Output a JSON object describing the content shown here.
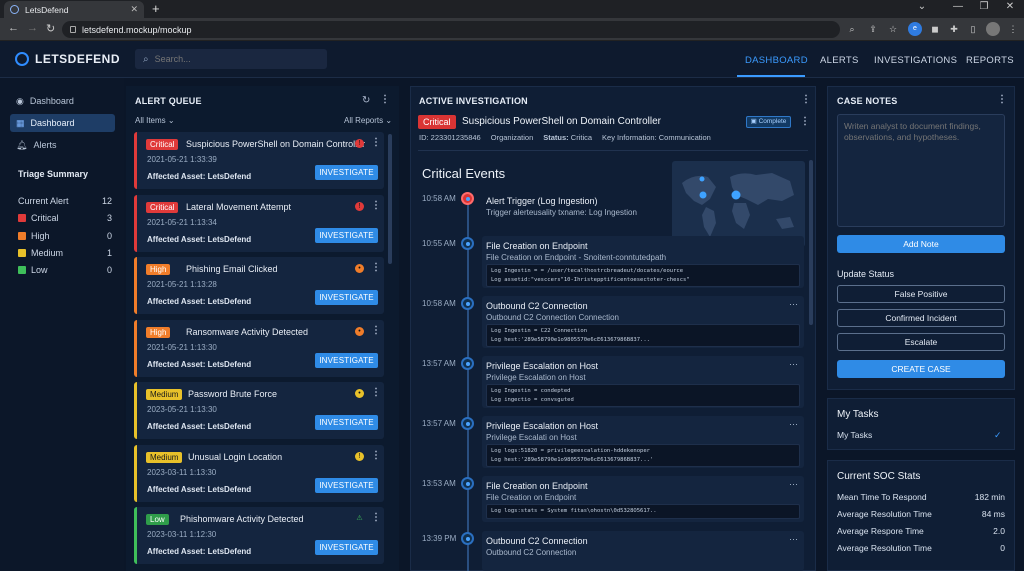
{
  "browser": {
    "tab_title": "LetsDefend",
    "url": "letsdefend.mockup/mockup"
  },
  "app": {
    "logo": "LETSDEFEND",
    "search_placeholder": "Search...",
    "nav": [
      "DASHBOARD",
      "ALERTS",
      "INVESTIGATIONS",
      "REPORTS"
    ]
  },
  "sidebar": {
    "items": [
      "Dashboard",
      "Dashboard",
      "Alerts"
    ],
    "triage_title": "Triage Summary",
    "triage": [
      {
        "label": "Current Alert",
        "value": "12"
      },
      {
        "label": "Critical",
        "value": "3",
        "color": "#e03a3a"
      },
      {
        "label": "High",
        "value": "0",
        "color": "#f07d2a"
      },
      {
        "label": "Medium",
        "value": "1",
        "color": "#e8c12a"
      },
      {
        "label": "Low",
        "value": "0",
        "color": "#3fbf5a"
      }
    ]
  },
  "queue": {
    "title": "ALERT QUEUE",
    "filter_items": "All Items",
    "filter_reports": "All Reports",
    "button_label": "INVESTIGATE",
    "alerts": [
      {
        "severity": "Critical",
        "title": "Suspicious PowerShell on Domain Controller",
        "date": "2021-05-21 1:33:39",
        "asset": "Affected Asset: LetsDefend",
        "color": "#e03a3a",
        "status": "!"
      },
      {
        "severity": "Critical",
        "title": "Lateral Movement Attempt",
        "date": "2021-05-21 1:13:34",
        "asset": "Affected Asset: LetsDefend",
        "color": "#e03a3a",
        "status": "!"
      },
      {
        "severity": "High",
        "title": "Phishing Email Clicked",
        "date": "2021-05-21 1:13:28",
        "asset": "Affected Asset: LetsDefend",
        "color": "#f07d2a",
        "status": "•"
      },
      {
        "severity": "High",
        "title": "Ransomware Activity Detected",
        "date": "2021-05-21 1:13:30",
        "asset": "Affected Asset: LetsDefend",
        "color": "#f07d2a",
        "status": "•"
      },
      {
        "severity": "Medium",
        "title": "Password Brute Force",
        "date": "2023-05-21 1:13:30",
        "asset": "Affected Asset: LetsDefend",
        "color": "#e8c12a",
        "status": "•"
      },
      {
        "severity": "Medium",
        "title": "Unusual Login Location",
        "date": "2023-03-11 1:13:30",
        "asset": "Affected Asset: LetsDefend",
        "color": "#e8c12a",
        "status": "!"
      },
      {
        "severity": "Low",
        "title": "Phishomware Activity Detected",
        "date": "2023-03-11 1:12:30",
        "asset": "Affected Asset: LetsDefend",
        "color": "#3fbf5a",
        "status": "⚠"
      }
    ]
  },
  "investigation": {
    "title": "ACTIVE INVESTIGATION",
    "severity": "Critical",
    "name": "Suspicious PowerShell on Domain Controller",
    "complete_label": "Complete",
    "id": "ID: 223301235846",
    "org": "Organization",
    "status_label": "Status:",
    "status_value": "Critica",
    "key_info": "Key Information: Communication",
    "events_title": "Critical Events",
    "events": [
      {
        "time": "10:58 AM",
        "title": "Alert Trigger (Log Ingestion)",
        "sub": "Trigger alerteusality txname: Log Ingestion",
        "log": []
      },
      {
        "time": "10:55 AM",
        "title": "File Creation on Endpoint",
        "sub": "File Creation on Endpoint - Snoitent-conntutedpath",
        "log": [
          "Log Ingestin = = /user/tecalthostrcbreadeut/docates/eource",
          "Log assetid:\"vesccers\"10-Ihristepptificentoesectoter-chescs\""
        ]
      },
      {
        "time": "10:58 AM",
        "title": "Outbound C2 Connection",
        "sub": "Outbound C2 Connection Connection",
        "log": [
          "Log Ingestin = C22 Connection",
          "Log hest:'289e58790e1o9805570e6cE61367986B837..."
        ]
      },
      {
        "time": "13:57 AM",
        "title": "Privilege Escalation on Host",
        "sub": "Privilege Escalation on Host",
        "log": [
          "Log Ingestin = condepted",
          "Log ingectio = convsguted"
        ]
      },
      {
        "time": "13:57 AM",
        "title": "Privilege Escalation on Host",
        "sub": "Privilege Escalati on Host",
        "log": [
          "Log logs:51820 = privilegeescalation-hddekenoper",
          "Log hest:'289e58790e1o9805570e6cE61367986B837...'"
        ]
      },
      {
        "time": "13:53 AM",
        "title": "File Creation on Endpoint",
        "sub": "File Creation on Endpoint",
        "log": [
          "Log logs:stats = System fitas\\ohostn\\0d5328O5617.."
        ]
      },
      {
        "time": "13:39 PM",
        "title": "Outbound C2 Connection",
        "sub": "Outbound C2 Connection",
        "log": []
      }
    ]
  },
  "notes": {
    "title": "CASE NOTES",
    "placeholder": "Writen analyst to document findings, observations, and hypotheses.",
    "add_note": "Add Note",
    "update_status": "Update Status",
    "buttons": [
      "False Positive",
      "Confirmed Incident",
      "Escalate"
    ],
    "create_case": "CREATE CASE",
    "tasks_title": "My Tasks",
    "task_item": "My Tasks",
    "stats_title": "Current SOC Stats",
    "stats": [
      {
        "label": "Mean Time To Respond",
        "value": "182 min"
      },
      {
        "label": "Average Resolution Time",
        "value": "84 ms"
      },
      {
        "label": "Average Respore Time",
        "value": "2.0"
      },
      {
        "label": "Average Resolution Time",
        "value": "0"
      }
    ]
  },
  "colors": {
    "accent": "#2f8be6",
    "critical": "#e03a3a",
    "high": "#f07d2a",
    "medium": "#e8c12a",
    "low": "#3fbf5a"
  }
}
